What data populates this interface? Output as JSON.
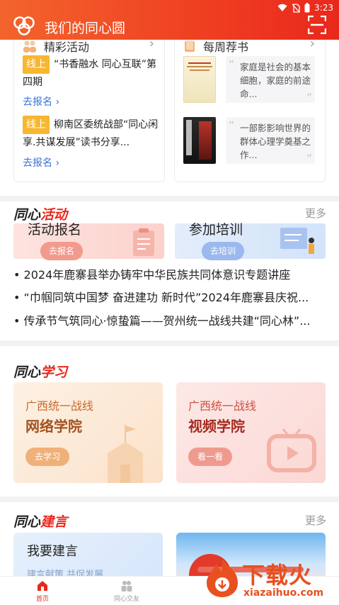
{
  "status": {
    "time": "3:23"
  },
  "header": {
    "title": "我们的同心圆"
  },
  "activities_card": {
    "title": "精彩活动",
    "items": [
      {
        "tag": "线上",
        "text": "“书香融水 同心互联”第四期",
        "link": "去报名"
      },
      {
        "tag": "线上",
        "text": "柳南区委统战部“同心闲享.共谋发展”读书分享...",
        "link": "去报名"
      }
    ]
  },
  "books_card": {
    "title": "每周荐书",
    "items": [
      {
        "quote": "家庭是社会的基本细胞，家庭的前途命..."
      },
      {
        "quote": "一部影影响世界的群体心理学奠基之作..."
      }
    ]
  },
  "tongxin_activity": {
    "title_a": "同心",
    "title_b": "活动",
    "more": "更多",
    "banners": [
      {
        "title": "活动报名",
        "button": "去报名"
      },
      {
        "title": "参加培训",
        "button": "去培训"
      }
    ],
    "news": [
      "2024年鹿寨县举办铸牢中华民族共同体意识专题讲座",
      "“巾帼同筑中国梦 奋进建功 新时代”2024年鹿寨县庆祝...",
      "传承节气筑同心·惊蛰篇——贺州统一战线共建“同心林”..."
    ]
  },
  "tongxin_study": {
    "title_a": "同心",
    "title_b": "学习",
    "cards": [
      {
        "subtitle": "广西统一战线",
        "title": "网络学院",
        "button": "去学习"
      },
      {
        "subtitle": "广西统一战线",
        "title": "视频学院",
        "button": "看一看"
      }
    ]
  },
  "tongxin_advice": {
    "title_a": "同心",
    "title_b": "建言",
    "more": "更多",
    "card": {
      "title": "我要建言",
      "subtitle": "建言献策 共促发展"
    }
  },
  "bottom_nav": [
    {
      "label": "首页",
      "active": true
    },
    {
      "label": "同心交友",
      "active": false
    }
  ],
  "watermark": {
    "text": "下载火",
    "url": "xiazaihuo.com"
  },
  "colors": {
    "primary": "#e9281c",
    "accent": "#f7b731",
    "link": "#3a73d6"
  }
}
